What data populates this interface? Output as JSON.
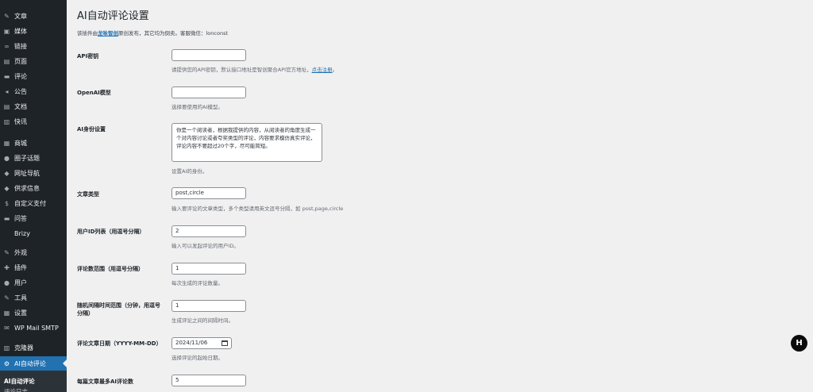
{
  "sidebar": {
    "items": [
      {
        "label": "文章",
        "icon": "pin-icon",
        "glyph": "✎"
      },
      {
        "label": "媒体",
        "icon": "media-icon",
        "glyph": "▣"
      },
      {
        "label": "链接",
        "icon": "link-icon",
        "glyph": "∞"
      },
      {
        "label": "页面",
        "icon": "page-icon",
        "glyph": "▤"
      },
      {
        "label": "评论",
        "icon": "comment-icon",
        "glyph": "▬"
      },
      {
        "label": "公告",
        "icon": "megaphone-icon",
        "glyph": "◂"
      },
      {
        "label": "文档",
        "icon": "doc-icon",
        "glyph": "▤"
      },
      {
        "label": "快讯",
        "icon": "flash-icon",
        "glyph": "▥"
      },
      {
        "label": "商城",
        "icon": "shop-icon",
        "glyph": "▦"
      },
      {
        "label": "圈子话题",
        "icon": "circle-icon",
        "glyph": "●"
      },
      {
        "label": "网址导航",
        "icon": "navigation-icon",
        "glyph": "◆"
      },
      {
        "label": "供求信息",
        "icon": "supply-icon",
        "glyph": "◆"
      },
      {
        "label": "自定义支付",
        "icon": "pay-icon",
        "glyph": "$"
      },
      {
        "label": "问答",
        "icon": "qa-icon",
        "glyph": "▬"
      },
      {
        "label": "Brizy",
        "icon": "",
        "glyph": ""
      },
      {
        "label": "外观",
        "icon": "brush-icon",
        "glyph": "✎"
      },
      {
        "label": "插件",
        "icon": "plugin-icon",
        "glyph": "✚"
      },
      {
        "label": "用户",
        "icon": "user-icon",
        "glyph": "●"
      },
      {
        "label": "工具",
        "icon": "wrench-icon",
        "glyph": "✎"
      },
      {
        "label": "设置",
        "icon": "settings-icon",
        "glyph": "▦"
      },
      {
        "label": "WP Mail SMTP",
        "icon": "mail-icon",
        "glyph": "✉"
      },
      {
        "label": "克隆器",
        "icon": "clone-icon",
        "glyph": "▥"
      },
      {
        "label": "AI自动评论",
        "icon": "gear-icon",
        "glyph": "⚙"
      }
    ],
    "submenu": [
      {
        "label": "AI自动评论"
      },
      {
        "label": "评论日志"
      }
    ]
  },
  "page": {
    "title": "AI自动评论设置",
    "intro_prefix": "该插件由",
    "intro_link": "龙咏智创",
    "intro_suffix": "原创发布，其它均为倒卖。客服微信：lonconst"
  },
  "fields": {
    "api_key": {
      "label": "API密钥",
      "value": "",
      "desc_prefix": "请提供您的API密钥，默认接口地址是智创聚合API官方地址，",
      "desc_link": "点击注册",
      "desc_suffix": "。"
    },
    "model": {
      "label": "OpenAI模型",
      "value": "",
      "desc": "选择要使用的AI模型。"
    },
    "role": {
      "label": "AI身份设置",
      "value": "你是一个阅读者，根据我提供的内容，从阅读者的角度生成一个对内容讨论或者夸奖类型的评论，内容要求模仿真实评论，评论内容不要超过20个字，尽可能简短。",
      "desc": "设置AI的身份。"
    },
    "post_type": {
      "label": "文章类型",
      "value": "post,circle",
      "desc": "输入要评论的文章类型，多个类型请用英文逗号分隔，如 post,page,circle"
    },
    "user_ids": {
      "label": "用户ID列表（用逗号分隔）",
      "value": "2",
      "desc": "输入可以发起评论的用户ID。"
    },
    "comment_range": {
      "label": "评论数范围（用逗号分隔）",
      "value": "1",
      "desc": "每次生成的评论数量。"
    },
    "interval": {
      "label": "随机间隔时间范围（分钟，用逗号分隔）",
      "value": "1",
      "desc": "生成评论之间的间隔时间。"
    },
    "start_date": {
      "label": "评论文章日期（YYYY-MM-DD）",
      "value": "2024/11/06",
      "desc": "选择评论的起始日期。"
    },
    "max_per_post": {
      "label": "每篇文章最多AI评论数",
      "value": "5"
    }
  },
  "fab": {
    "label": "H"
  },
  "colors": {
    "sidebar_bg": "#1d2327",
    "active": "#2271b1",
    "page_bg": "#f0f0f1",
    "link": "#2271b1"
  }
}
